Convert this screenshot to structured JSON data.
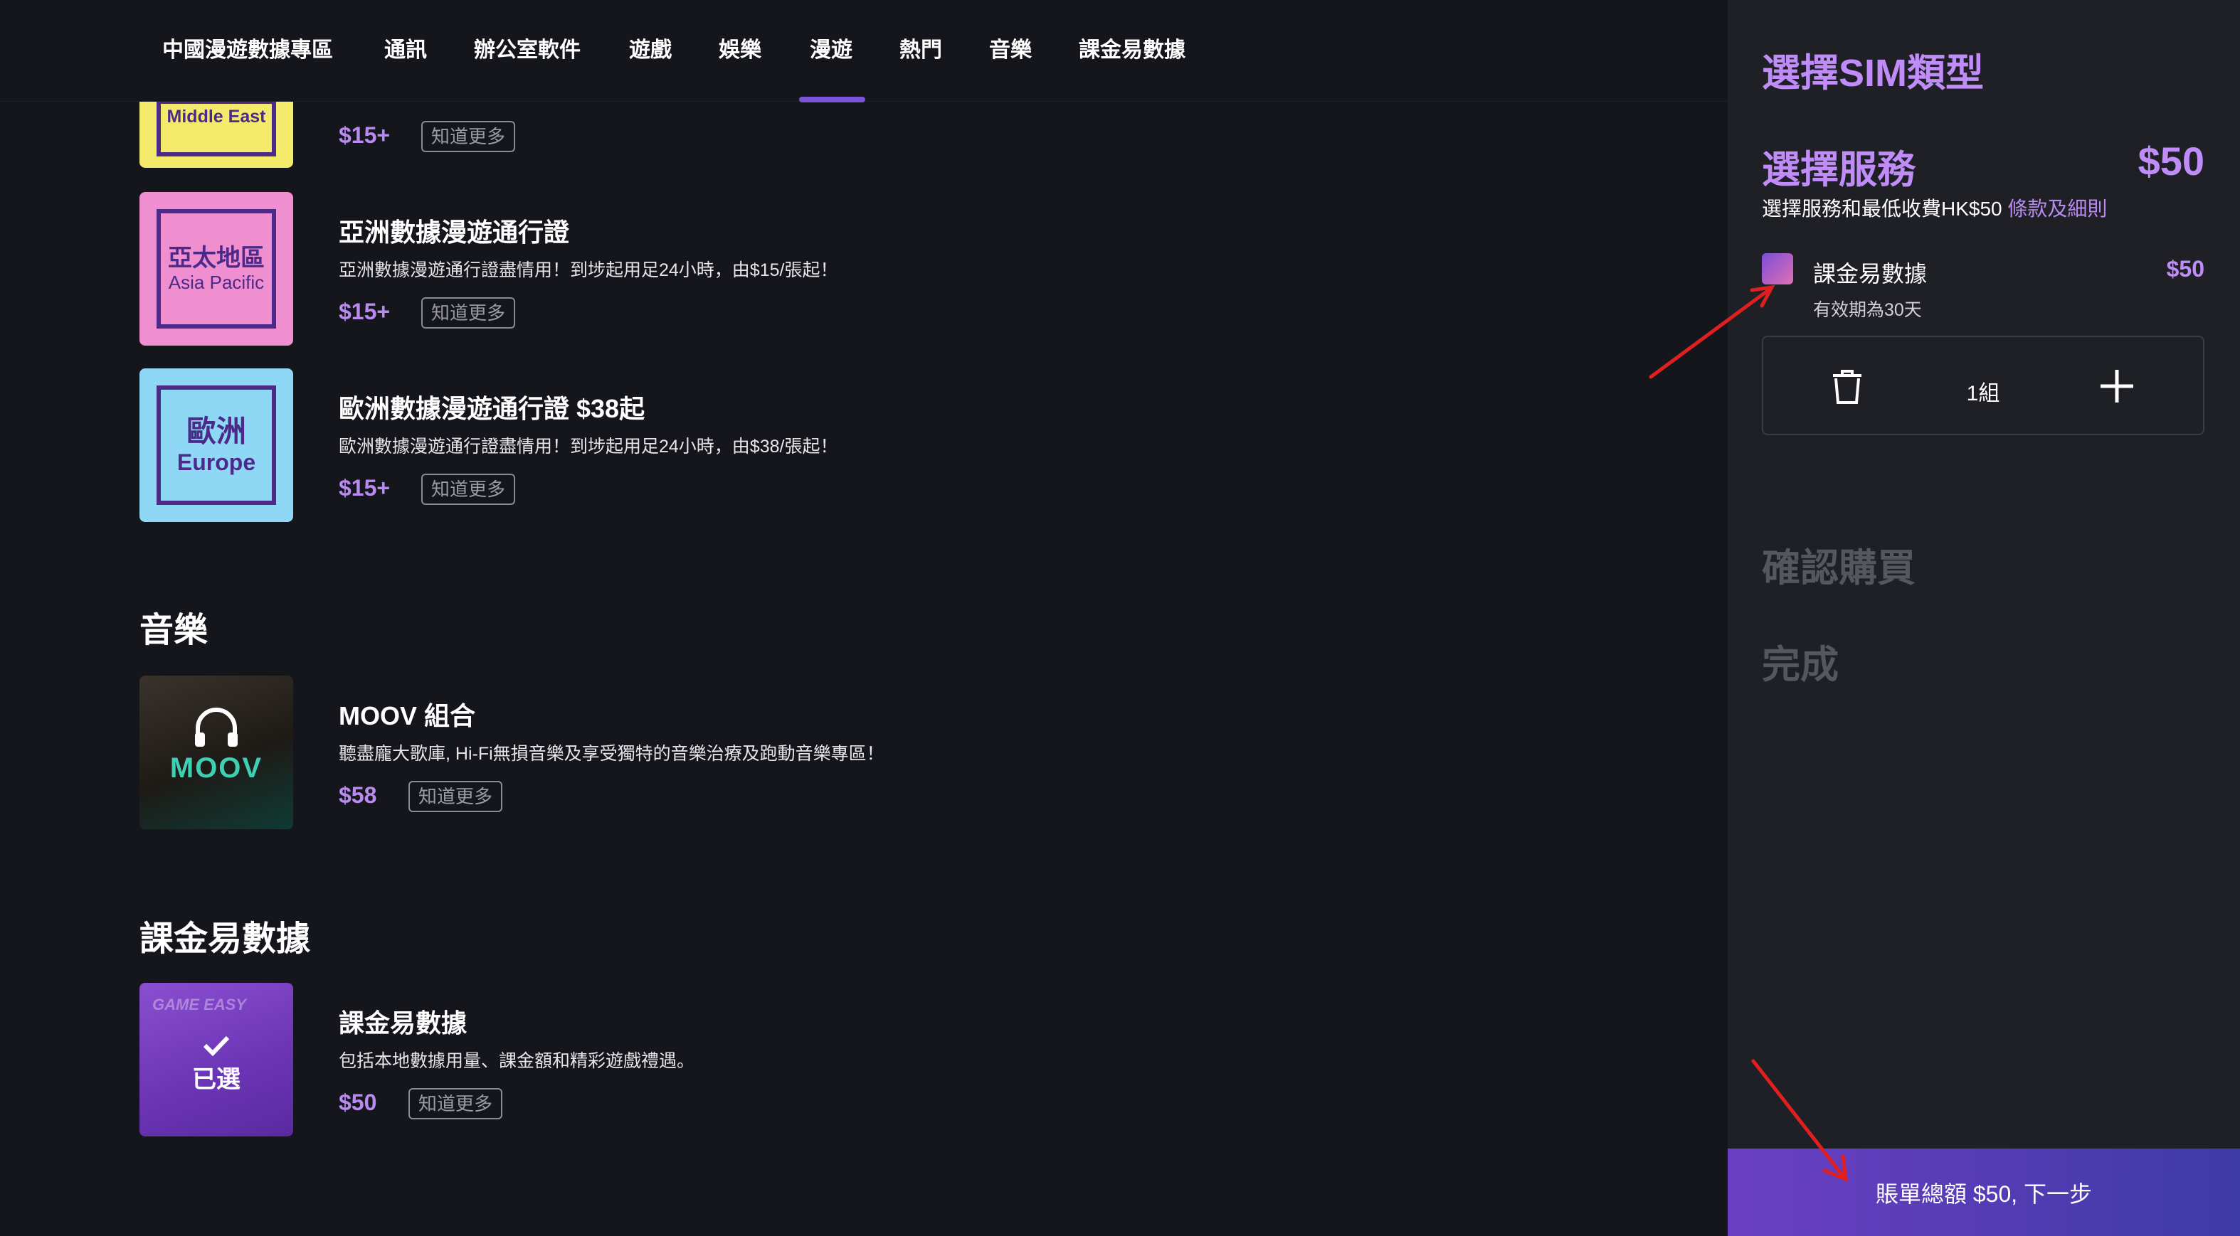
{
  "nav": {
    "items": [
      "中國漫遊數據專區",
      "通訊",
      "辦公室軟件",
      "遊戲",
      "娛樂",
      "漫遊",
      "熱門",
      "音樂",
      "課金易數據"
    ]
  },
  "roaming": {
    "middle_east": {
      "thumb_text": "Middle East",
      "price": "$15+",
      "more": "知道更多"
    },
    "asia": {
      "thumb_big": "亞太地區",
      "thumb_small": "Asia Pacific",
      "title": "亞洲數據漫遊通行證",
      "desc": "亞洲數據漫遊通行證盡情用！到埗起用足24小時，由$15/張起！",
      "price": "$15+",
      "more": "知道更多"
    },
    "europe": {
      "thumb_big": "歐洲",
      "thumb_small": "Europe",
      "title": "歐洲數據漫遊通行證 $38起",
      "desc": "歐洲數據漫遊通行證盡情用！到埗起用足24小時，由$38/張起！",
      "price": "$15+",
      "more": "知道更多"
    }
  },
  "music": {
    "section_title": "音樂",
    "moov": {
      "thumb_text": "MOOV",
      "title": "MOOV 組合",
      "desc": "聽盡龐大歌庫, Hi-Fi無損音樂及享受獨特的音樂治療及跑動音樂專區！",
      "price": "$58",
      "more": "知道更多"
    }
  },
  "gamedata": {
    "section_title": "課金易數據",
    "item": {
      "thumb_brand": "GAME EASY",
      "selected_label": "已選",
      "title": "課金易數據",
      "desc": "包括本地數據用量、課金額和精彩遊戲禮遇。",
      "price": "$50",
      "more": "知道更多"
    }
  },
  "panel": {
    "step1": "選擇SIM類型",
    "step2": "選擇服務",
    "step2_total": "$50",
    "min_note": "選擇服務和最低收費HK$50",
    "terms_link": "條款及細則",
    "service": {
      "name": "課金易數據",
      "price": "$50",
      "validity": "有效期為30天"
    },
    "quantity": "1組",
    "step3": "確認購買",
    "step4": "完成",
    "cta": "賬單總額 $50, 下一步"
  },
  "colors": {
    "accent": "#c08cf7",
    "price": "#b98bf0",
    "cta_from": "#6b3fc4",
    "cta_to": "#3e3aa6",
    "annotation": "#e02020"
  },
  "icons": [
    "trash-icon",
    "plus-icon",
    "check-icon",
    "headphones-icon",
    "arrow-annotation"
  ]
}
